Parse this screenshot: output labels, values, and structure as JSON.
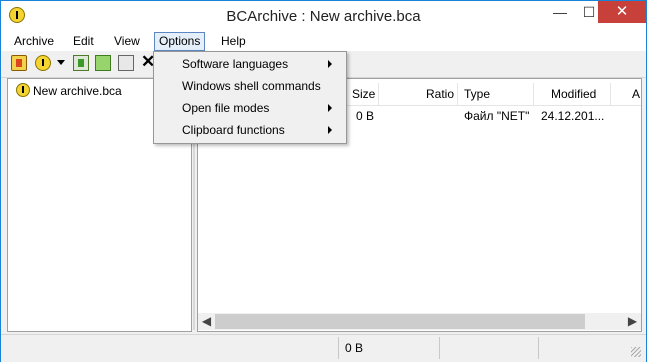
{
  "window": {
    "title": "BCArchive : New archive.bca",
    "minimize_glyph": "—",
    "maximize_glyph": "☐",
    "close_glyph": "✕"
  },
  "menubar": {
    "items": [
      {
        "label": "Archive"
      },
      {
        "label": "Edit"
      },
      {
        "label": "View"
      },
      {
        "label": "Options"
      },
      {
        "label": "Help"
      }
    ]
  },
  "toolbar": {
    "icons": [
      "new-archive-icon",
      "open-archive-icon",
      "dropdown-arrow-icon",
      "extract-icon",
      "add-files-icon",
      "test-icon",
      "delete-icon"
    ],
    "delete_glyph": "✕"
  },
  "options_menu": {
    "items": [
      {
        "label": "Software languages",
        "has_submenu": true
      },
      {
        "label": "Windows shell commands",
        "has_submenu": false
      },
      {
        "label": "Open file modes",
        "has_submenu": true
      },
      {
        "label": "Clipboard functions",
        "has_submenu": true
      }
    ]
  },
  "tree": {
    "items": [
      {
        "label": "New archive.bca"
      }
    ]
  },
  "file_list": {
    "columns": [
      "Size",
      "Ratio",
      "Type",
      "Modified",
      "A"
    ],
    "rows": [
      {
        "size": "0 B",
        "ratio": "",
        "type": "Файл \"NET\"",
        "modified": "24.12.201..."
      }
    ]
  },
  "statusbar": {
    "size_text": "0 B"
  },
  "colors": {
    "accent": "#1883d7",
    "close_button": "#c7403a",
    "menu_highlight": "#e5effa"
  }
}
